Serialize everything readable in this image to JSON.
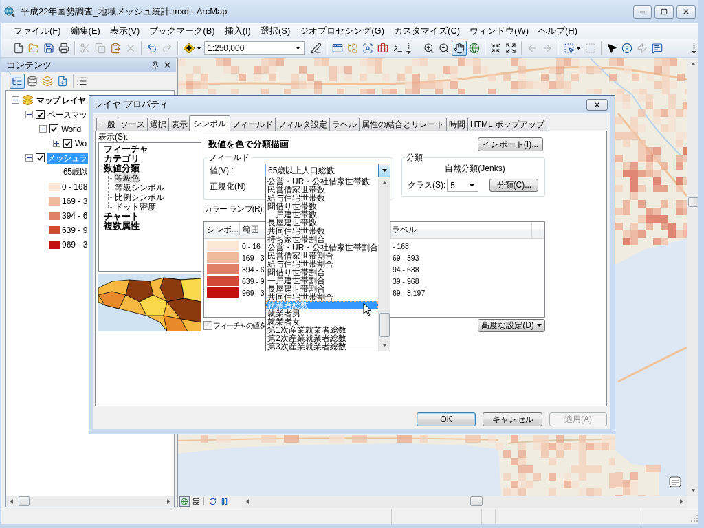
{
  "window": {
    "title": "平成22年国勢調査_地域メッシュ統計.mxd - ArcMap"
  },
  "menu": [
    "ファイル(F)",
    "編集(E)",
    "表示(V)",
    "ブックマーク(B)",
    "挿入(I)",
    "選択(S)",
    "ジオプロセシング(G)",
    "カスタマイズ(C)",
    "ウィンドウ(W)",
    "ヘルプ(H)"
  ],
  "toolbar": {
    "scale": "1:250,000",
    "tools": [
      {
        "disabled": false,
        "selected": false
      },
      {
        "disabled": false,
        "selected": false
      },
      {
        "disabled": false,
        "selected": false
      },
      {
        "disabled": false,
        "selected": false
      },
      {
        "disabled": true,
        "selected": false
      },
      {
        "disabled": true,
        "selected": false
      },
      {
        "disabled": false,
        "selected": false
      },
      {
        "disabled": true,
        "selected": false
      },
      {
        "disabled": false,
        "selected": false
      },
      {
        "disabled": true,
        "selected": false
      },
      {
        "disabled": false,
        "selected": false
      },
      {
        "disabled": false,
        "selected": false
      },
      {
        "disabled": false,
        "selected": false
      },
      {
        "disabled": false,
        "selected": false
      },
      {
        "disabled": false,
        "selected": false
      },
      {
        "disabled": false,
        "selected": false
      },
      {
        "disabled": false,
        "selected": false
      },
      {
        "disabled": false,
        "selected": false
      },
      {
        "disabled": false,
        "selected": false
      },
      {
        "disabled": false,
        "selected": true
      },
      {
        "disabled": false,
        "selected": false
      },
      {
        "disabled": false,
        "selected": false
      },
      {
        "disabled": false,
        "selected": false
      },
      {
        "disabled": true,
        "selected": false
      },
      {
        "disabled": true,
        "selected": false
      },
      {
        "disabled": false,
        "selected": false
      },
      {
        "disabled": true,
        "selected": false
      },
      {
        "disabled": false,
        "selected": false
      },
      {
        "disabled": false,
        "selected": false
      },
      {
        "disabled": true,
        "selected": false
      },
      {
        "disabled": false,
        "selected": false
      }
    ]
  },
  "toc": {
    "title": "コンテンツ",
    "view_buttons": [
      {
        "selected": true
      },
      {
        "selected": false
      },
      {
        "selected": false
      },
      {
        "selected": false
      }
    ],
    "layers": [
      {
        "kind": "frame",
        "label": "マップ レイヤ",
        "expanded": true,
        "selected": false,
        "children": [
          {
            "kind": "layer",
            "label": "ベースマッ",
            "checked": true,
            "expanded": true,
            "selected": false,
            "children": [
              {
                "kind": "layer",
                "label": "World",
                "checked": true,
                "expanded": true,
                "selected": false,
                "children": [
                  {
                    "kind": "layer",
                    "label": "Wo",
                    "checked": true,
                    "expanded": false,
                    "selected": false
                  }
                ]
              }
            ]
          },
          {
            "kind": "layer",
            "label": "メッシュラ",
            "checked": true,
            "expanded": true,
            "selected": true,
            "field": "65歳以",
            "legend": [
              {
                "label": "0 - 168",
                "color": "#fde8d6"
              },
              {
                "label": "169 - 3",
                "color": "#f0b99b"
              },
              {
                "label": "394 - 6",
                "color": "#e07f66"
              },
              {
                "label": "639 - 9",
                "color": "#d24a37"
              },
              {
                "label": "969 - 3",
                "color": "#c2100f"
              }
            ]
          }
        ]
      }
    ]
  },
  "map": {
    "view_buttons": [
      {
        "selected": true
      },
      {
        "selected": false
      }
    ]
  },
  "dialog": {
    "title": "レイヤ プロパティ",
    "tabs": [
      {
        "label": "一般",
        "selected": false
      },
      {
        "label": "ソース",
        "selected": false
      },
      {
        "label": "選択",
        "selected": false
      },
      {
        "label": "表示",
        "selected": false
      },
      {
        "label": "シンボル",
        "selected": true
      },
      {
        "label": "フィールド",
        "selected": false
      },
      {
        "label": "フィルタ設定",
        "selected": false
      },
      {
        "label": "ラベル",
        "selected": false
      },
      {
        "label": "属性の結合とリレート",
        "selected": false
      },
      {
        "label": "時間",
        "selected": false
      },
      {
        "label": "HTML ポップアップ",
        "selected": false
      }
    ],
    "show_label": "表示(S):",
    "renderers": [
      {
        "label": "フィーチャ",
        "selected": false
      },
      {
        "label": "カテゴリ",
        "selected": false
      },
      {
        "label": "数値分類",
        "selected": false,
        "children": [
          {
            "label": "等級色",
            "selected": true
          },
          {
            "label": "等級シンボル",
            "selected": false
          },
          {
            "label": "比例シンボル",
            "selected": false
          },
          {
            "label": "ドット密度",
            "selected": false
          }
        ]
      },
      {
        "label": "チャート",
        "selected": false
      },
      {
        "label": "複数属性",
        "selected": false
      }
    ],
    "heading": "数値を色で分類描画",
    "import_button": "インポート(I)...",
    "field_group": {
      "title": "フィールド",
      "value_label": "値(V) :",
      "value": "65歳以上人口総数",
      "normalize_label": "正規化(N):",
      "options": [
        {
          "label": "公営・UR・公社借家世帯数",
          "selected": false
        },
        {
          "label": "民営借家世帯数",
          "selected": false
        },
        {
          "label": "給与住宅世帯数",
          "selected": false
        },
        {
          "label": "間借り世帯数",
          "selected": false
        },
        {
          "label": "一戸建世帯数",
          "selected": false
        },
        {
          "label": "長屋建世帯数",
          "selected": false
        },
        {
          "label": "共同住宅世帯数",
          "selected": false
        },
        {
          "label": "持ち家世帯割合",
          "selected": false
        },
        {
          "label": "公営・UR・公社借家世帯割合",
          "selected": false
        },
        {
          "label": "民営借家世帯割合",
          "selected": false
        },
        {
          "label": "給与住宅世帯割合",
          "selected": false
        },
        {
          "label": "間借り世帯割合",
          "selected": false
        },
        {
          "label": "一戸建世帯割合",
          "selected": false
        },
        {
          "label": "長屋建世帯割合",
          "selected": false
        },
        {
          "label": "共同住宅世帯割合",
          "selected": false
        },
        {
          "label": "就業者総数",
          "selected": true
        },
        {
          "label": "就業者男",
          "selected": false
        },
        {
          "label": "就業者女",
          "selected": false
        },
        {
          "label": "第1次産業就業者総数",
          "selected": false
        },
        {
          "label": "第2次産業就業者総数",
          "selected": false
        },
        {
          "label": "第3次産業就業者総数",
          "selected": false
        }
      ]
    },
    "classification": {
      "title": "分類",
      "method": "自然分類(Jenks)",
      "classes_label": "クラス(S):",
      "classes": "5",
      "classify_button": "分類(C)..."
    },
    "color_ramp_label": "カラー ランプ(R):",
    "table": {
      "columns": [
        "シンボ...",
        "範囲",
        "ラベル"
      ],
      "rows": [
        {
          "color": "#fde8d6",
          "range": "0 - 16",
          "label": "- 168"
        },
        {
          "color": "#f0b99b",
          "range": "169 - 3",
          "label": "69 - 393"
        },
        {
          "color": "#e07f66",
          "range": "394 - 6",
          "label": "94 - 638"
        },
        {
          "color": "#d24a37",
          "range": "639 - 9",
          "label": "39 - 968"
        },
        {
          "color": "#c2100f",
          "range": "969 - 3",
          "label": "69 - 3,197"
        }
      ]
    },
    "show_values": {
      "label": "フィーチャの値を",
      "checked": false
    },
    "advanced_button": "高度な設定(D)",
    "buttons": [
      {
        "label": "OK",
        "default": true,
        "disabled": false
      },
      {
        "label": "キャンセル",
        "default": false,
        "disabled": false
      },
      {
        "label": "適用(A)",
        "default": false,
        "disabled": true
      }
    ]
  }
}
